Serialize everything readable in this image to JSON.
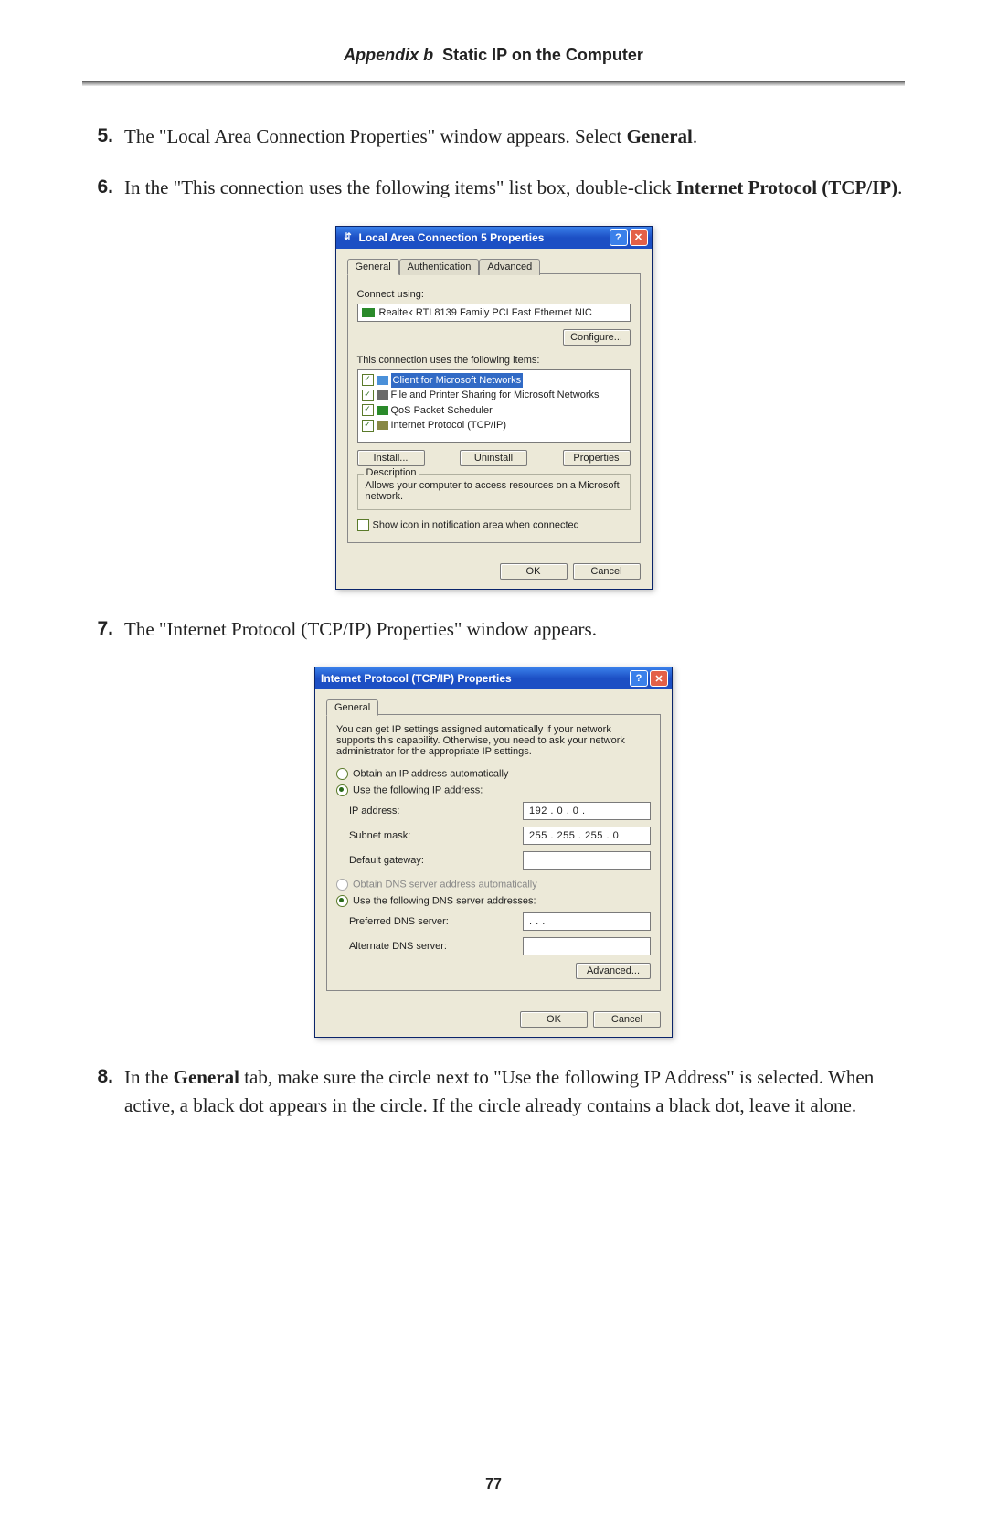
{
  "header": {
    "appendix": "Appendix b",
    "title": "Static IP on the Computer"
  },
  "steps": {
    "s5": {
      "num": "5.",
      "text_a": "The \"Local Area Connection Properties\" window appears. Select ",
      "bold": "General",
      "text_b": "."
    },
    "s6": {
      "num": "6.",
      "text_a": "In the \"This connection uses the following items\" list box, double-click ",
      "bold_a": "Internet Protocol (",
      "sc": "TCP/IP",
      "bold_b": ")",
      "text_b": "."
    },
    "s7": {
      "num": "7.",
      "text_a": "The \"Internet Protocol (",
      "sc": "TCP/IP",
      "text_b": ") Properties\" window appears."
    },
    "s8": {
      "num": "8.",
      "text_a": "In the ",
      "bold": "General",
      "text_b": " tab, make sure the circle next to \"Use the following ",
      "sc": "IP",
      "text_c": " Address\" is selected. When active, a black dot appears in the circle. If the circle already contains a black dot, leave it alone."
    }
  },
  "dialog1": {
    "title": "Local Area Connection 5 Properties",
    "tabs": {
      "general": "General",
      "auth": "Authentication",
      "adv": "Advanced"
    },
    "connect_using_label": "Connect using:",
    "adapter": "Realtek RTL8139 Family PCI Fast Ethernet NIC",
    "configure": "Configure...",
    "items_label": "This connection uses the following items:",
    "items": {
      "i1": "Client for Microsoft Networks",
      "i2": "File and Printer Sharing for Microsoft Networks",
      "i3": "QoS Packet Scheduler",
      "i4": "Internet Protocol (TCP/IP)"
    },
    "install": "Install...",
    "uninstall": "Uninstall",
    "properties": "Properties",
    "desc_legend": "Description",
    "desc_text": "Allows your computer to access resources on a Microsoft network.",
    "show_icon": "Show icon in notification area when connected",
    "ok": "OK",
    "cancel": "Cancel"
  },
  "dialog2": {
    "title": "Internet Protocol (TCP/IP) Properties",
    "tab_general": "General",
    "intro": "You can get IP settings assigned automatically if your network supports this capability. Otherwise, you need to ask your network administrator for the appropriate IP settings.",
    "r_auto_ip": "Obtain an IP address automatically",
    "r_use_ip": "Use the following IP address:",
    "ip_label": "IP address:",
    "ip_value": "192 .   0 . 0   .",
    "mask_label": "Subnet mask:",
    "mask_value": "255 . 255 . 255 .  0",
    "gw_label": "Default gateway:",
    "gw_value": "",
    "r_auto_dns": "Obtain DNS server address automatically",
    "r_use_dns": "Use the following DNS server addresses:",
    "pdns_label": "Preferred DNS server:",
    "pdns_value": ".       .       .",
    "adns_label": "Alternate DNS server:",
    "adns_value": "",
    "advanced": "Advanced...",
    "ok": "OK",
    "cancel": "Cancel"
  },
  "page_number": "77"
}
